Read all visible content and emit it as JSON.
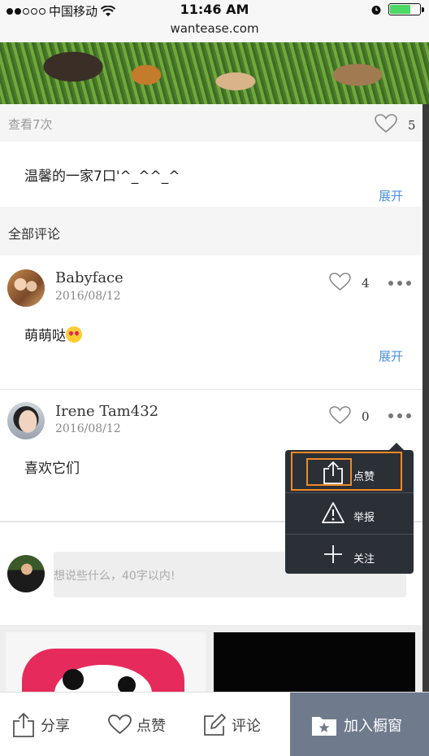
{
  "status_bar": {
    "carrier": "中国移动",
    "time": "11:46 AM",
    "url": "wantease.com"
  },
  "post": {
    "views": "查看7次",
    "like_count": "5",
    "description": "温馨的一家7口'^_^^_^",
    "expand_label": "展开"
  },
  "comments_section": {
    "title": "全部评论",
    "comments": [
      {
        "name": "Babyface",
        "date": "2016/08/12",
        "text": "萌萌哒",
        "likes": "4",
        "expand_label": "展开"
      },
      {
        "name": "Irene Tam432",
        "date": "2016/08/12",
        "text": "喜欢它们",
        "likes": "0"
      }
    ]
  },
  "popup_menu": {
    "items": [
      {
        "icon": "share-icon",
        "label": "点赞"
      },
      {
        "icon": "warning-icon",
        "label": "举报"
      },
      {
        "icon": "plus-icon",
        "label": "关注"
      }
    ]
  },
  "comment_input": {
    "placeholder": "想说些什么，40字以内!"
  },
  "bottom_bar": {
    "share_label": "分享",
    "like_label": "点赞",
    "comment_label": "评论",
    "add_label": "加入橱窗"
  },
  "colors": {
    "link": "#4a90e2",
    "popup_bg": "#2b2f36",
    "highlight": "#f08a24",
    "cart_bg": "#6f7a8c"
  }
}
